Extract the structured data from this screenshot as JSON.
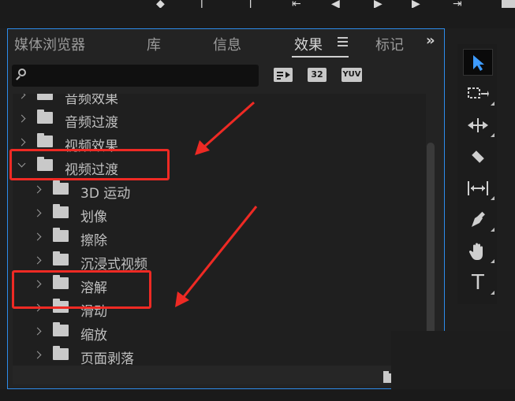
{
  "tabs": [
    {
      "label": "媒体浏览器",
      "active": false
    },
    {
      "label": "库",
      "active": false
    },
    {
      "label": "信息",
      "active": false
    },
    {
      "label": "效果",
      "active": true
    },
    {
      "label": "标记",
      "active": false
    }
  ],
  "overflow_label": "»",
  "search": {
    "value": "",
    "placeholder": ""
  },
  "toolbar_badges": [
    "32",
    "YUV"
  ],
  "tree_items": [
    {
      "label": "音频效果",
      "level": 0,
      "expanded": false
    },
    {
      "label": "音频过渡",
      "level": 0,
      "expanded": false
    },
    {
      "label": "视频效果",
      "level": 0,
      "expanded": false
    },
    {
      "label": "视频过渡",
      "level": 0,
      "expanded": true
    },
    {
      "label": "3D 运动",
      "level": 1,
      "expanded": false
    },
    {
      "label": "划像",
      "level": 1,
      "expanded": false
    },
    {
      "label": "擦除",
      "level": 1,
      "expanded": false
    },
    {
      "label": "沉浸式视频",
      "level": 1,
      "expanded": false
    },
    {
      "label": "溶解",
      "level": 1,
      "expanded": false
    },
    {
      "label": "滑动",
      "level": 1,
      "expanded": false
    },
    {
      "label": "缩放",
      "level": 1,
      "expanded": false
    },
    {
      "label": "页面剥落",
      "level": 1,
      "expanded": false
    }
  ],
  "tools": [
    "selection-tool-icon",
    "track-select-icon",
    "ripple-edit-icon",
    "razor-icon",
    "slip-icon",
    "pen-icon",
    "hand-icon",
    "type-icon"
  ],
  "tool_type_label": "T",
  "colors": {
    "accent": "#2d8ceb",
    "annotation": "#ee2a24",
    "selected_tool": "#3d9bff"
  }
}
